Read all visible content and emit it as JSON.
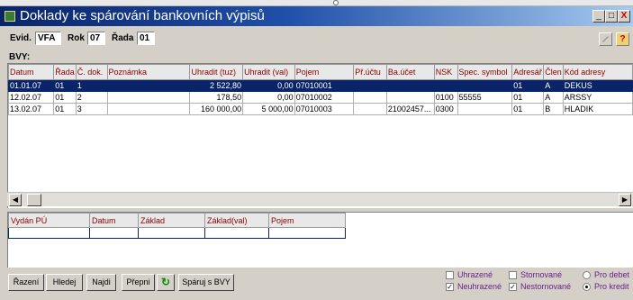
{
  "window": {
    "title": "Doklady ke spárování bankovních výpisů",
    "min_label": "_",
    "max_label": "□",
    "close_label": "X"
  },
  "filters": {
    "evid_label": "Evid.",
    "evid_value": "VFA",
    "rok_label": "Rok",
    "rok_value": "07",
    "rada_label": "Řada",
    "rada_value": "01"
  },
  "toolbar": {
    "help_label": "?"
  },
  "section": {
    "label": "BVY:"
  },
  "grid": {
    "columns": [
      "Datum",
      "Řada",
      "Č. dok.",
      "Poznámka",
      "Uhradit (tuz)",
      "Uhradit (val)",
      "Pojem",
      "Př.účtu",
      "Ba.účet",
      "NSK",
      "Spec. symbol",
      "Adresář",
      "Člen",
      "Kód adresy"
    ],
    "rows": [
      [
        "01.01.07",
        "01",
        "1",
        "",
        "2 522,80",
        "0,00",
        "07010001",
        "",
        "",
        "",
        "",
        "01",
        "A",
        "DEKUS"
      ],
      [
        "12.02.07",
        "01",
        "2",
        "",
        "178,50",
        "0,00",
        "07010002",
        "",
        "",
        "0100",
        "55555",
        "01",
        "A",
        "ARSSY"
      ],
      [
        "13.02.07",
        "01",
        "3",
        "",
        "160 000,00",
        "5 000,00",
        "07010003",
        "",
        "21002457...",
        "0300",
        "",
        "01",
        "B",
        "HLADIK"
      ]
    ],
    "selected_row": 0
  },
  "subgrid": {
    "columns": [
      "Vydán PÚ",
      "Datum",
      "Základ",
      "Základ(val)",
      "Pojem"
    ]
  },
  "buttons": {
    "razeni": "Řazení",
    "hledej": "Hledej",
    "najdi": "Najdi",
    "prepni": "Přepni",
    "refresh": "↻",
    "sparuj": "Spáruj s BVY"
  },
  "checks": {
    "uhrazene": "Uhrazené",
    "neuhrazene": "Neuhrazené",
    "stornovane": "Stornované",
    "nestornovane": "Nestornované",
    "pro_debet": "Pro debet",
    "pro_kredit": "Pro kredit",
    "check_mark": "✓"
  },
  "colors": {
    "selection": "#0a246a",
    "header_text": "#8a0000",
    "filter_text": "#6a1f8a"
  }
}
